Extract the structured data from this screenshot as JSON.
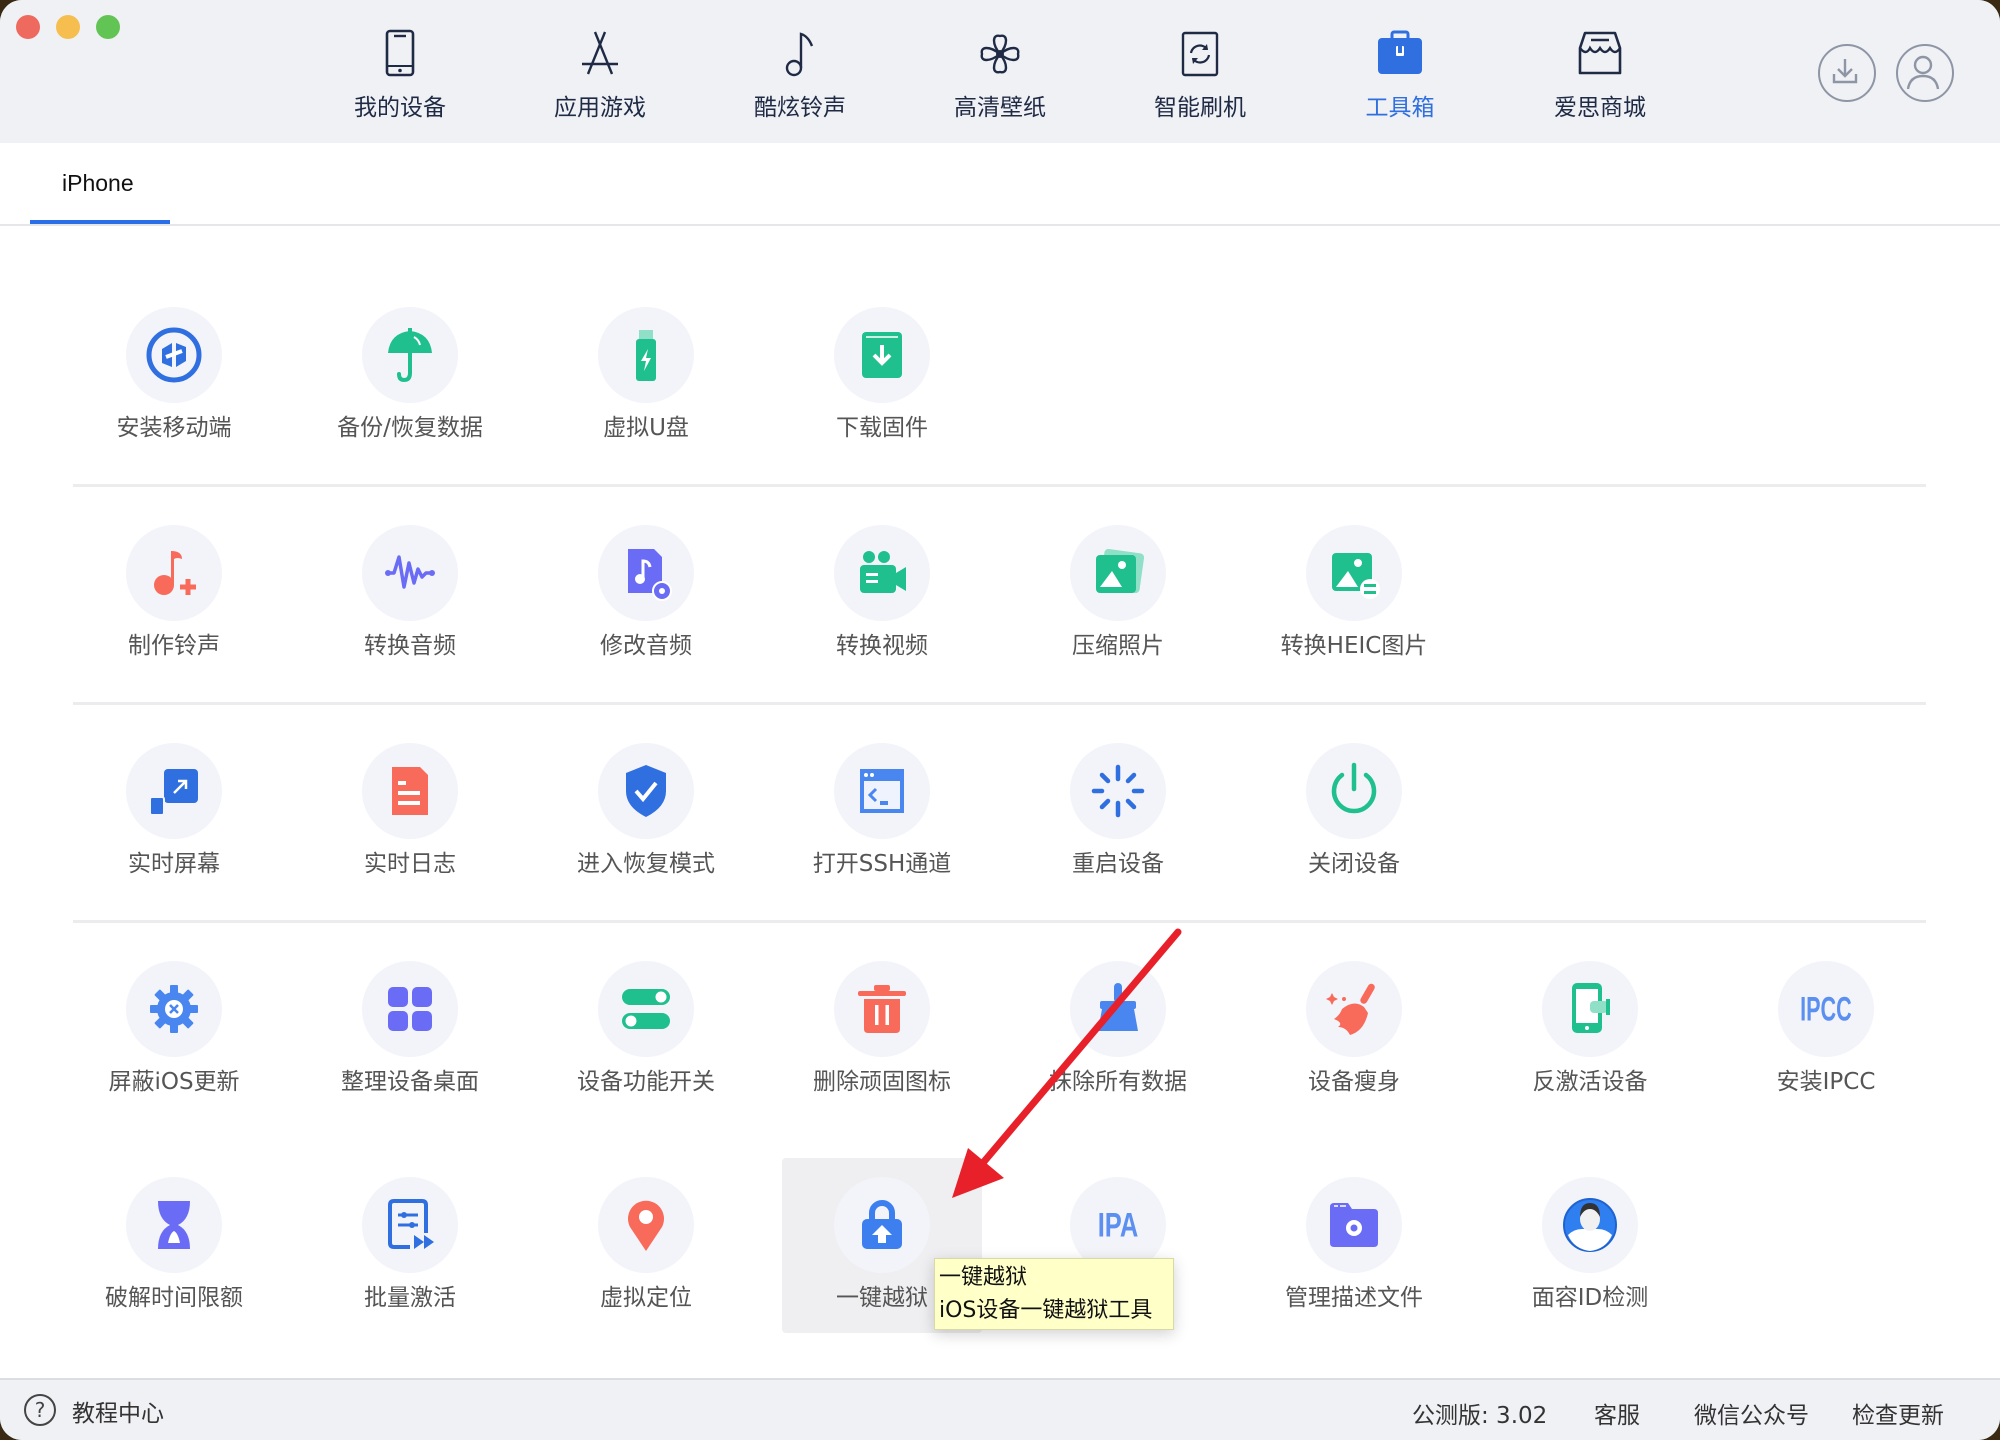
{
  "window": {
    "controls": [
      "close",
      "minimize",
      "maximize"
    ]
  },
  "nav": {
    "items": [
      {
        "label": "我的设备",
        "icon": "phone-icon",
        "active": false
      },
      {
        "label": "应用游戏",
        "icon": "app-store-icon",
        "active": false
      },
      {
        "label": "酷炫铃声",
        "icon": "music-note-icon",
        "active": false
      },
      {
        "label": "高清壁纸",
        "icon": "flower-icon",
        "active": false
      },
      {
        "label": "智能刷机",
        "icon": "refresh-box-icon",
        "active": false
      },
      {
        "label": "工具箱",
        "icon": "toolbox-icon",
        "active": true
      },
      {
        "label": "爱思商城",
        "icon": "store-icon",
        "active": false
      }
    ],
    "right_buttons": [
      {
        "name": "download-manager-button",
        "icon": "download-icon"
      },
      {
        "name": "user-account-button",
        "icon": "user-icon"
      }
    ],
    "active_color": "#2f6fe0"
  },
  "tabs": [
    {
      "label": "iPhone",
      "active": true
    }
  ],
  "tools": {
    "rows": [
      [
        {
          "label": "安装移动端",
          "icon": "install-mobile-icon"
        },
        {
          "label": "备份/恢复数据",
          "icon": "umbrella-icon"
        },
        {
          "label": "虚拟U盘",
          "icon": "usb-drive-icon"
        },
        {
          "label": "下载固件",
          "icon": "download-firmware-icon"
        }
      ],
      [
        {
          "label": "制作铃声",
          "icon": "ringtone-plus-icon"
        },
        {
          "label": "转换音频",
          "icon": "waveform-icon"
        },
        {
          "label": "修改音频",
          "icon": "audio-file-gear-icon"
        },
        {
          "label": "转换视频",
          "icon": "video-camera-icon"
        },
        {
          "label": "压缩照片",
          "icon": "photo-compress-icon"
        },
        {
          "label": "转换HEIC图片",
          "icon": "photo-convert-icon"
        }
      ],
      [
        {
          "label": "实时屏幕",
          "icon": "screen-mirror-icon"
        },
        {
          "label": "实时日志",
          "icon": "log-document-icon"
        },
        {
          "label": "进入恢复模式",
          "icon": "shield-check-icon"
        },
        {
          "label": "打开SSH通道",
          "icon": "terminal-icon"
        },
        {
          "label": "重启设备",
          "icon": "restart-spinner-icon"
        },
        {
          "label": "关闭设备",
          "icon": "power-icon"
        }
      ],
      [
        {
          "label": "屏蔽iOS更新",
          "icon": "gear-x-icon"
        },
        {
          "label": "整理设备桌面",
          "icon": "grid-apps-icon"
        },
        {
          "label": "设备功能开关",
          "icon": "toggles-icon"
        },
        {
          "label": "删除顽固图标",
          "icon": "trash-icon"
        },
        {
          "label": "抹除所有数据",
          "icon": "brush-icon"
        },
        {
          "label": "设备瘦身",
          "icon": "broom-sparkle-icon"
        },
        {
          "label": "反激活设备",
          "icon": "phone-deactivate-icon"
        },
        {
          "label": "安装IPCC",
          "icon": "ipcc-icon",
          "icon_text": "IPCC"
        }
      ],
      [
        {
          "label": "破解时间限额",
          "icon": "hourglass-icon"
        },
        {
          "label": "批量激活",
          "icon": "batch-activate-icon"
        },
        {
          "label": "虚拟定位",
          "icon": "location-pin-icon"
        },
        {
          "label": "一键越狱",
          "icon": "lock-upload-icon",
          "hovered": true
        },
        {
          "label": "",
          "icon": "ipa-icon",
          "icon_text": "IPA"
        },
        {
          "label": "管理描述文件",
          "icon": "folder-gear-icon"
        },
        {
          "label": "面容ID检测",
          "icon": "face-id-avatar-icon"
        }
      ]
    ]
  },
  "tooltip": {
    "title": "一键越狱",
    "description": "iOS设备一键越狱工具"
  },
  "annotation": {
    "type": "red-arrow",
    "points_to": "一键越狱",
    "color": "#e8202a"
  },
  "footer": {
    "help_label": "教程中心",
    "version": "公测版: 3.02",
    "links": [
      "客服",
      "微信公众号",
      "检查更新"
    ]
  },
  "colors": {
    "blue": "#2f6fe0",
    "green": "#20c08e",
    "coral": "#f86a5a",
    "purple": "#6b6cf5",
    "icon_bg": "#f3f4f9"
  }
}
